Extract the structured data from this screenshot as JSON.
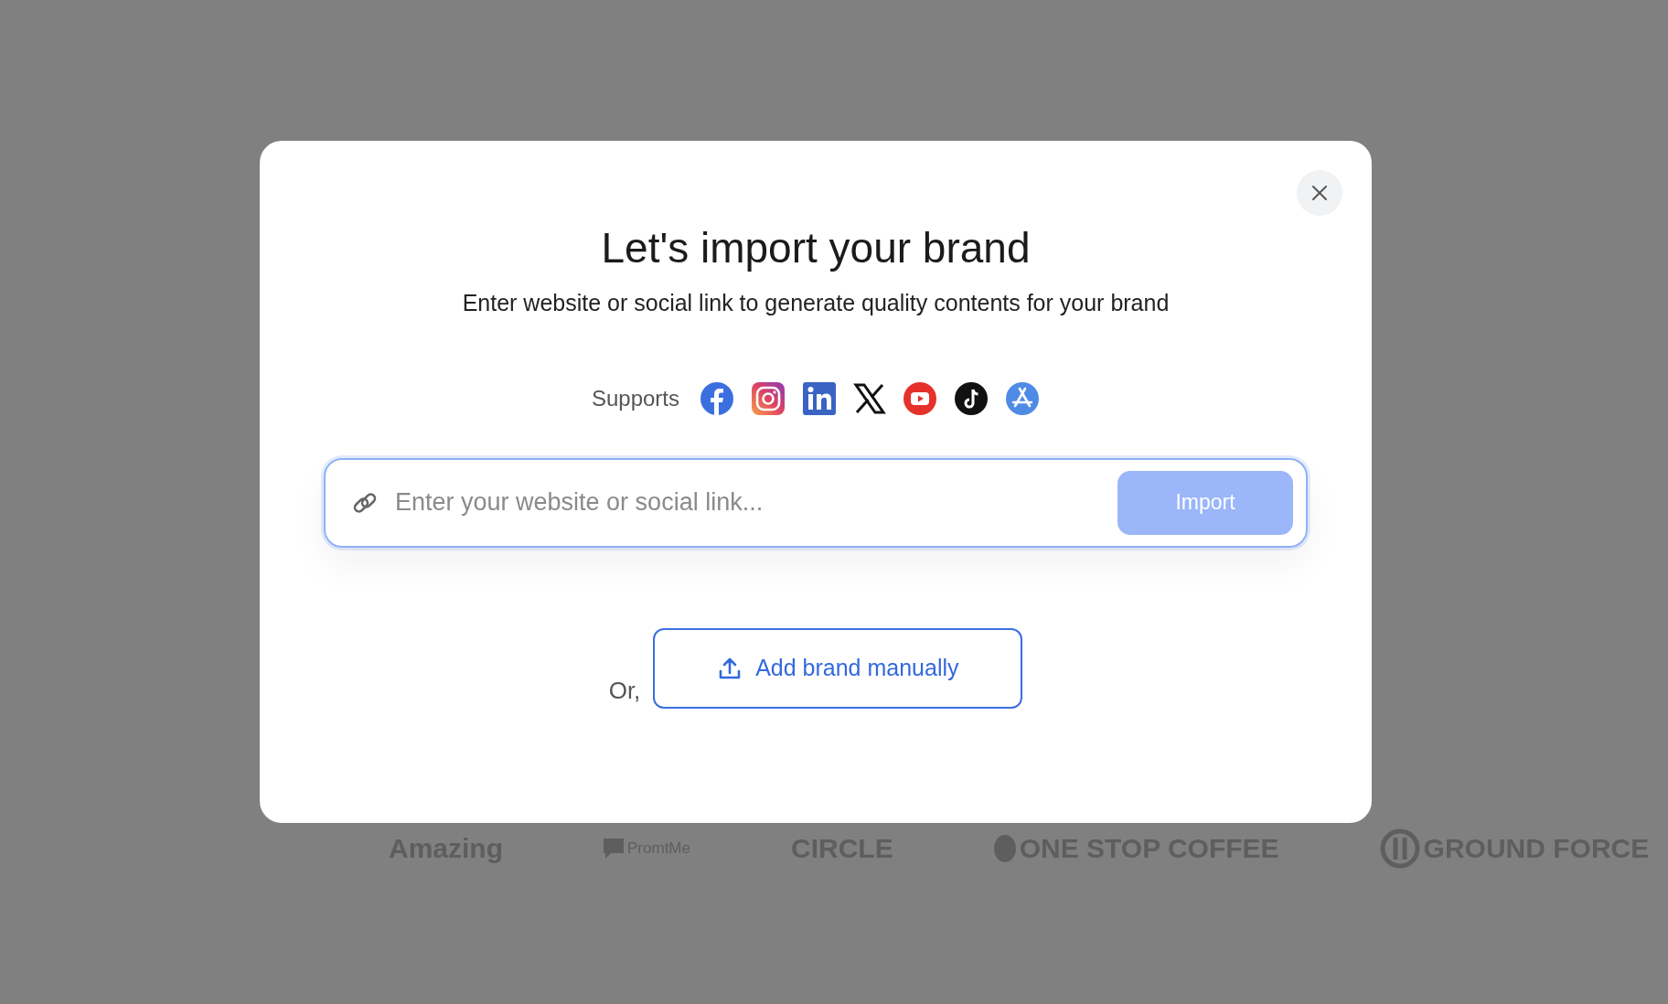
{
  "background": {
    "logos": [
      {
        "kind": "amazing",
        "name": "Amazing"
      },
      {
        "kind": "bubble",
        "name": "PromtMe"
      },
      {
        "kind": "plain",
        "name": "CIRCLE"
      },
      {
        "kind": "cup",
        "name": "ONE STOP COFFEE"
      },
      {
        "kind": "ring",
        "name": "GROUND FORCE"
      }
    ]
  },
  "dialog": {
    "title": "Let's import your brand",
    "subtitle": "Enter website or social link to generate quality contents for your brand",
    "supports_label": "Supports",
    "platforms": [
      {
        "kind": "facebook"
      },
      {
        "kind": "instagram"
      },
      {
        "kind": "linkedin"
      },
      {
        "kind": "x"
      },
      {
        "kind": "youtube"
      },
      {
        "kind": "tiktok"
      },
      {
        "kind": "appstore"
      }
    ],
    "link_field": {
      "placeholder": "Enter your website or social link...",
      "focused": true
    },
    "import_button": {
      "label": "Import",
      "disabled": true
    },
    "or_label": "Or,",
    "manual_button": {
      "label": "Add brand manually"
    }
  }
}
